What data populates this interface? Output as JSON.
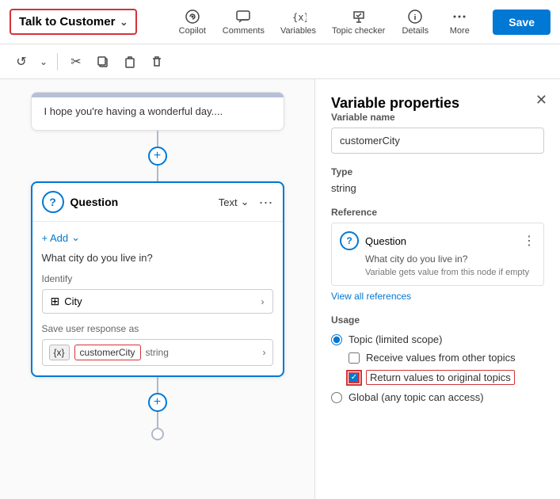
{
  "toolbar": {
    "talk_to_customer": "Talk to Customer",
    "save_label": "Save",
    "icons": [
      {
        "id": "copilot",
        "label": "Copilot",
        "unicode": "⊙"
      },
      {
        "id": "comments",
        "label": "Comments",
        "unicode": "💬"
      },
      {
        "id": "variables",
        "label": "Variables",
        "unicode": "{x}"
      },
      {
        "id": "topic_checker",
        "label": "Topic checker",
        "unicode": "🏷"
      },
      {
        "id": "details",
        "label": "Details",
        "unicode": "ⓘ"
      },
      {
        "id": "more",
        "label": "More",
        "unicode": "···"
      }
    ]
  },
  "secondary_toolbar": {
    "undo": "↺",
    "undo_arrow": "⌄",
    "cut": "✂",
    "copy": "⧉",
    "paste": "⬓",
    "delete": "🗑"
  },
  "canvas": {
    "message_text": "I hope you're having a wonderful day....",
    "add_button": "+",
    "question_node": {
      "title": "Question",
      "type": "Text",
      "add_label": "+ Add",
      "question_text": "What city do you live in?",
      "identify_label": "Identify",
      "identify_value": "City",
      "save_label": "Save user response as",
      "var_badge": "{x}",
      "var_name": "customerCity",
      "var_type": "string"
    }
  },
  "right_panel": {
    "title": "Variable properties",
    "var_name_label": "Variable name",
    "var_name_value": "customerCity",
    "type_label": "Type",
    "type_value": "string",
    "reference_label": "Reference",
    "ref_title": "Question",
    "ref_question": "What city do you live in?",
    "ref_note": "Variable gets value from this node if empty",
    "view_refs": "View all references",
    "usage_label": "Usage",
    "topic_label": "Topic (limited scope)",
    "receive_label": "Receive values from other topics",
    "return_label": "Return values to original topics",
    "global_label": "Global (any topic can access)"
  }
}
